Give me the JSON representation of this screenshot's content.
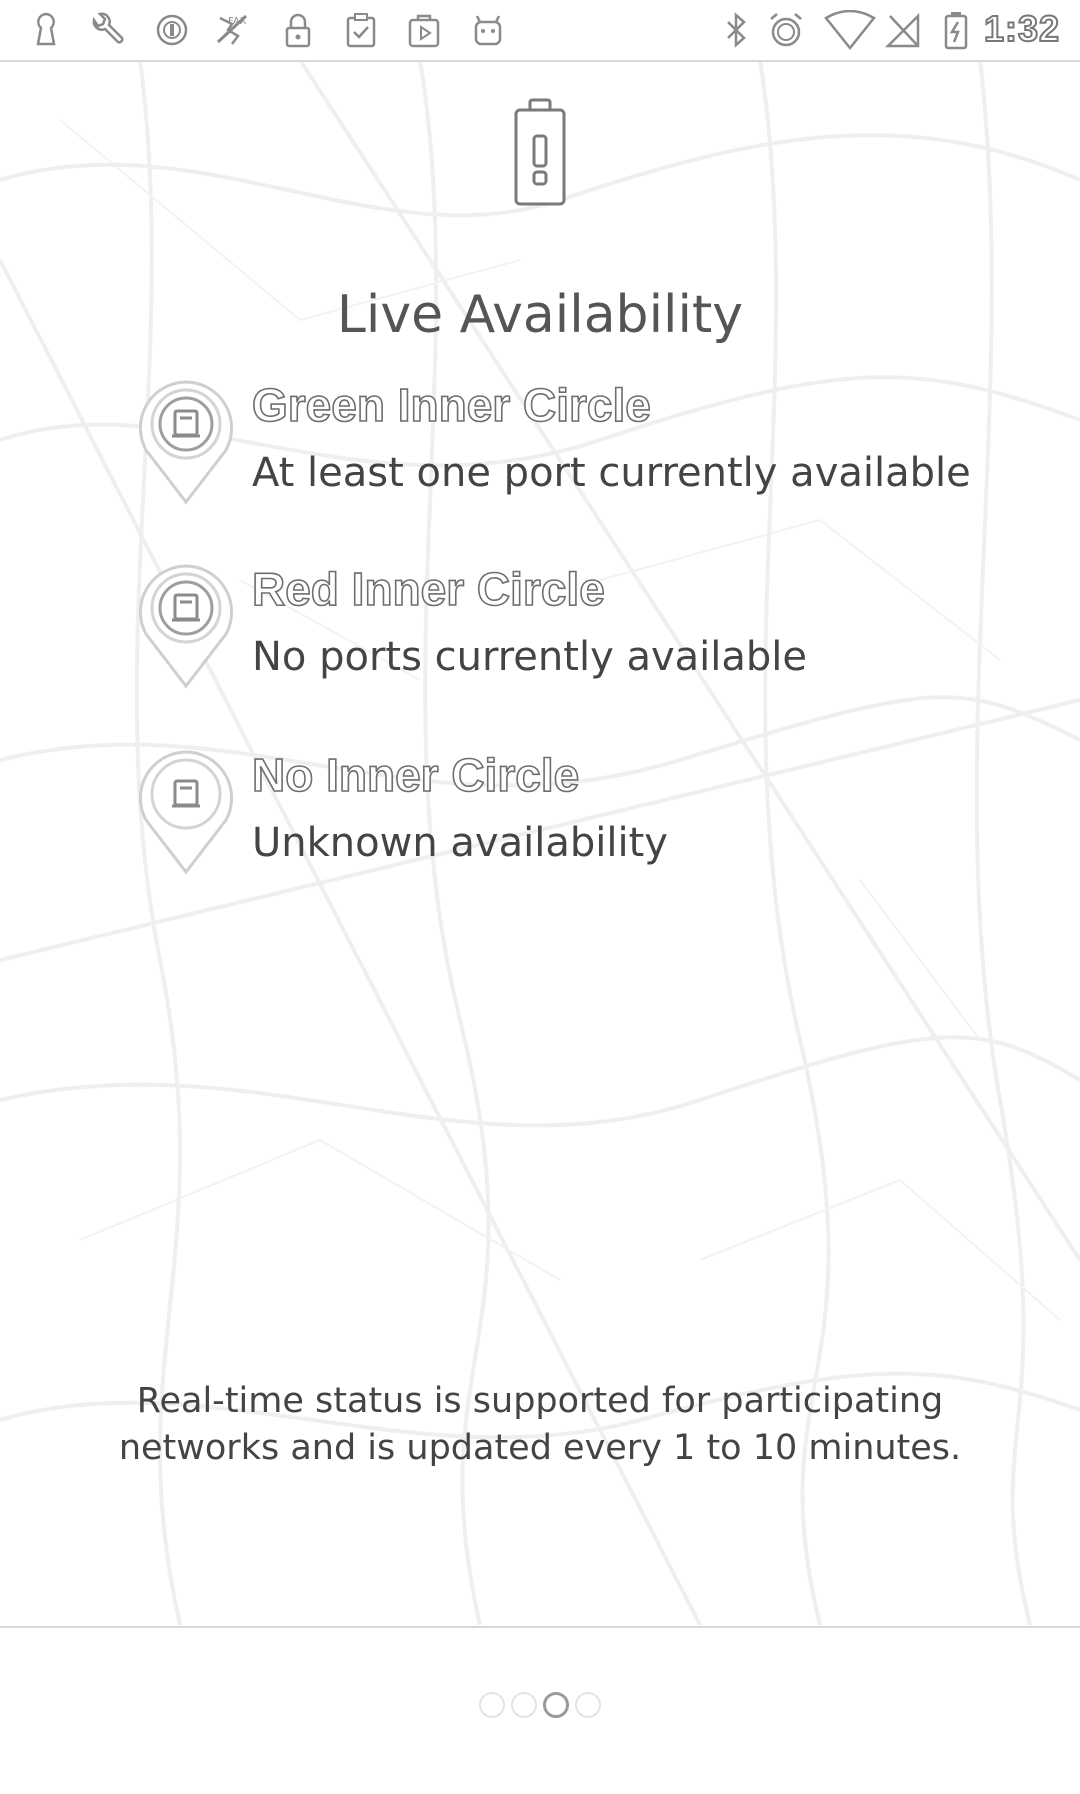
{
  "status_bar": {
    "left_icons": [
      "keyhole-icon",
      "wrench-icon",
      "circle-badge-icon",
      "no-gps-icon",
      "lock-icon",
      "clipboard-check-icon",
      "play-store-icon",
      "android-icon"
    ],
    "right_icons": [
      "bluetooth-icon",
      "alarm-icon",
      "wifi-icon",
      "no-signal-icon",
      "battery-charging-icon"
    ],
    "time": "1:32"
  },
  "page": {
    "title": "Live Availability",
    "hero_icon": "battery-icon"
  },
  "legend": [
    {
      "title": "Green Inner Circle",
      "description": "At least one port currently available",
      "icon": "map-pin-icon"
    },
    {
      "title": "Red Inner Circle",
      "description": "No ports currently available",
      "icon": "map-pin-icon"
    },
    {
      "title": "No Inner Circle",
      "description": "Unknown availability",
      "icon": "map-pin-icon"
    }
  ],
  "footer": {
    "line1": "Real-time status is supported for participating",
    "line2": "networks and is updated every 1 to 10 minutes."
  },
  "pager": {
    "total": 4,
    "current": 3
  }
}
